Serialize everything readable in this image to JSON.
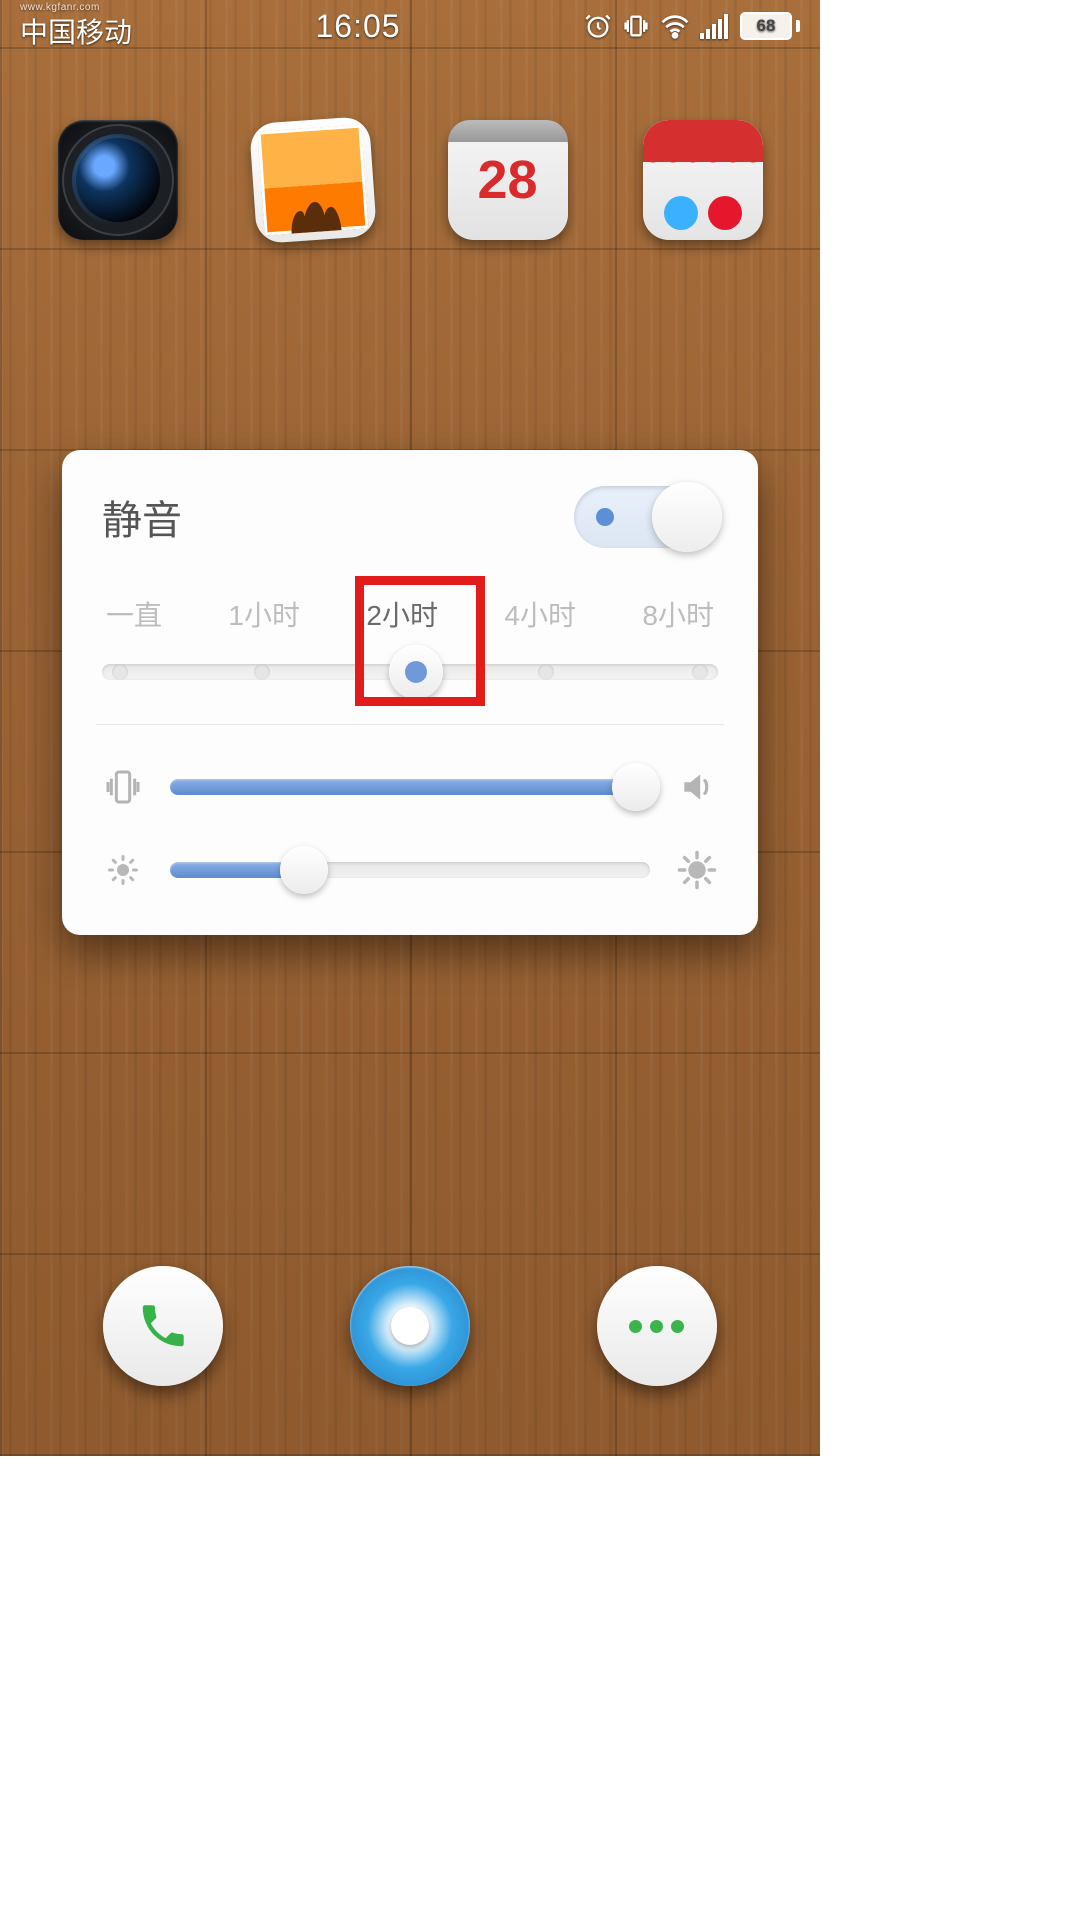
{
  "status": {
    "watermark": "www.kgfanr.com",
    "carrier": "中国移动",
    "time": "16:05",
    "battery": "68"
  },
  "apps": {
    "calendar_day": "28"
  },
  "modal": {
    "title": "静音",
    "toggle_on": true,
    "duration": {
      "options": [
        "一直",
        "1小时",
        "2小时",
        "4小时",
        "8小时"
      ],
      "selected_index": 2
    },
    "volume_percent": 97,
    "brightness_percent": 28
  },
  "colors": {
    "accent": "#5c8ad0",
    "highlight": "#e21b1b"
  }
}
